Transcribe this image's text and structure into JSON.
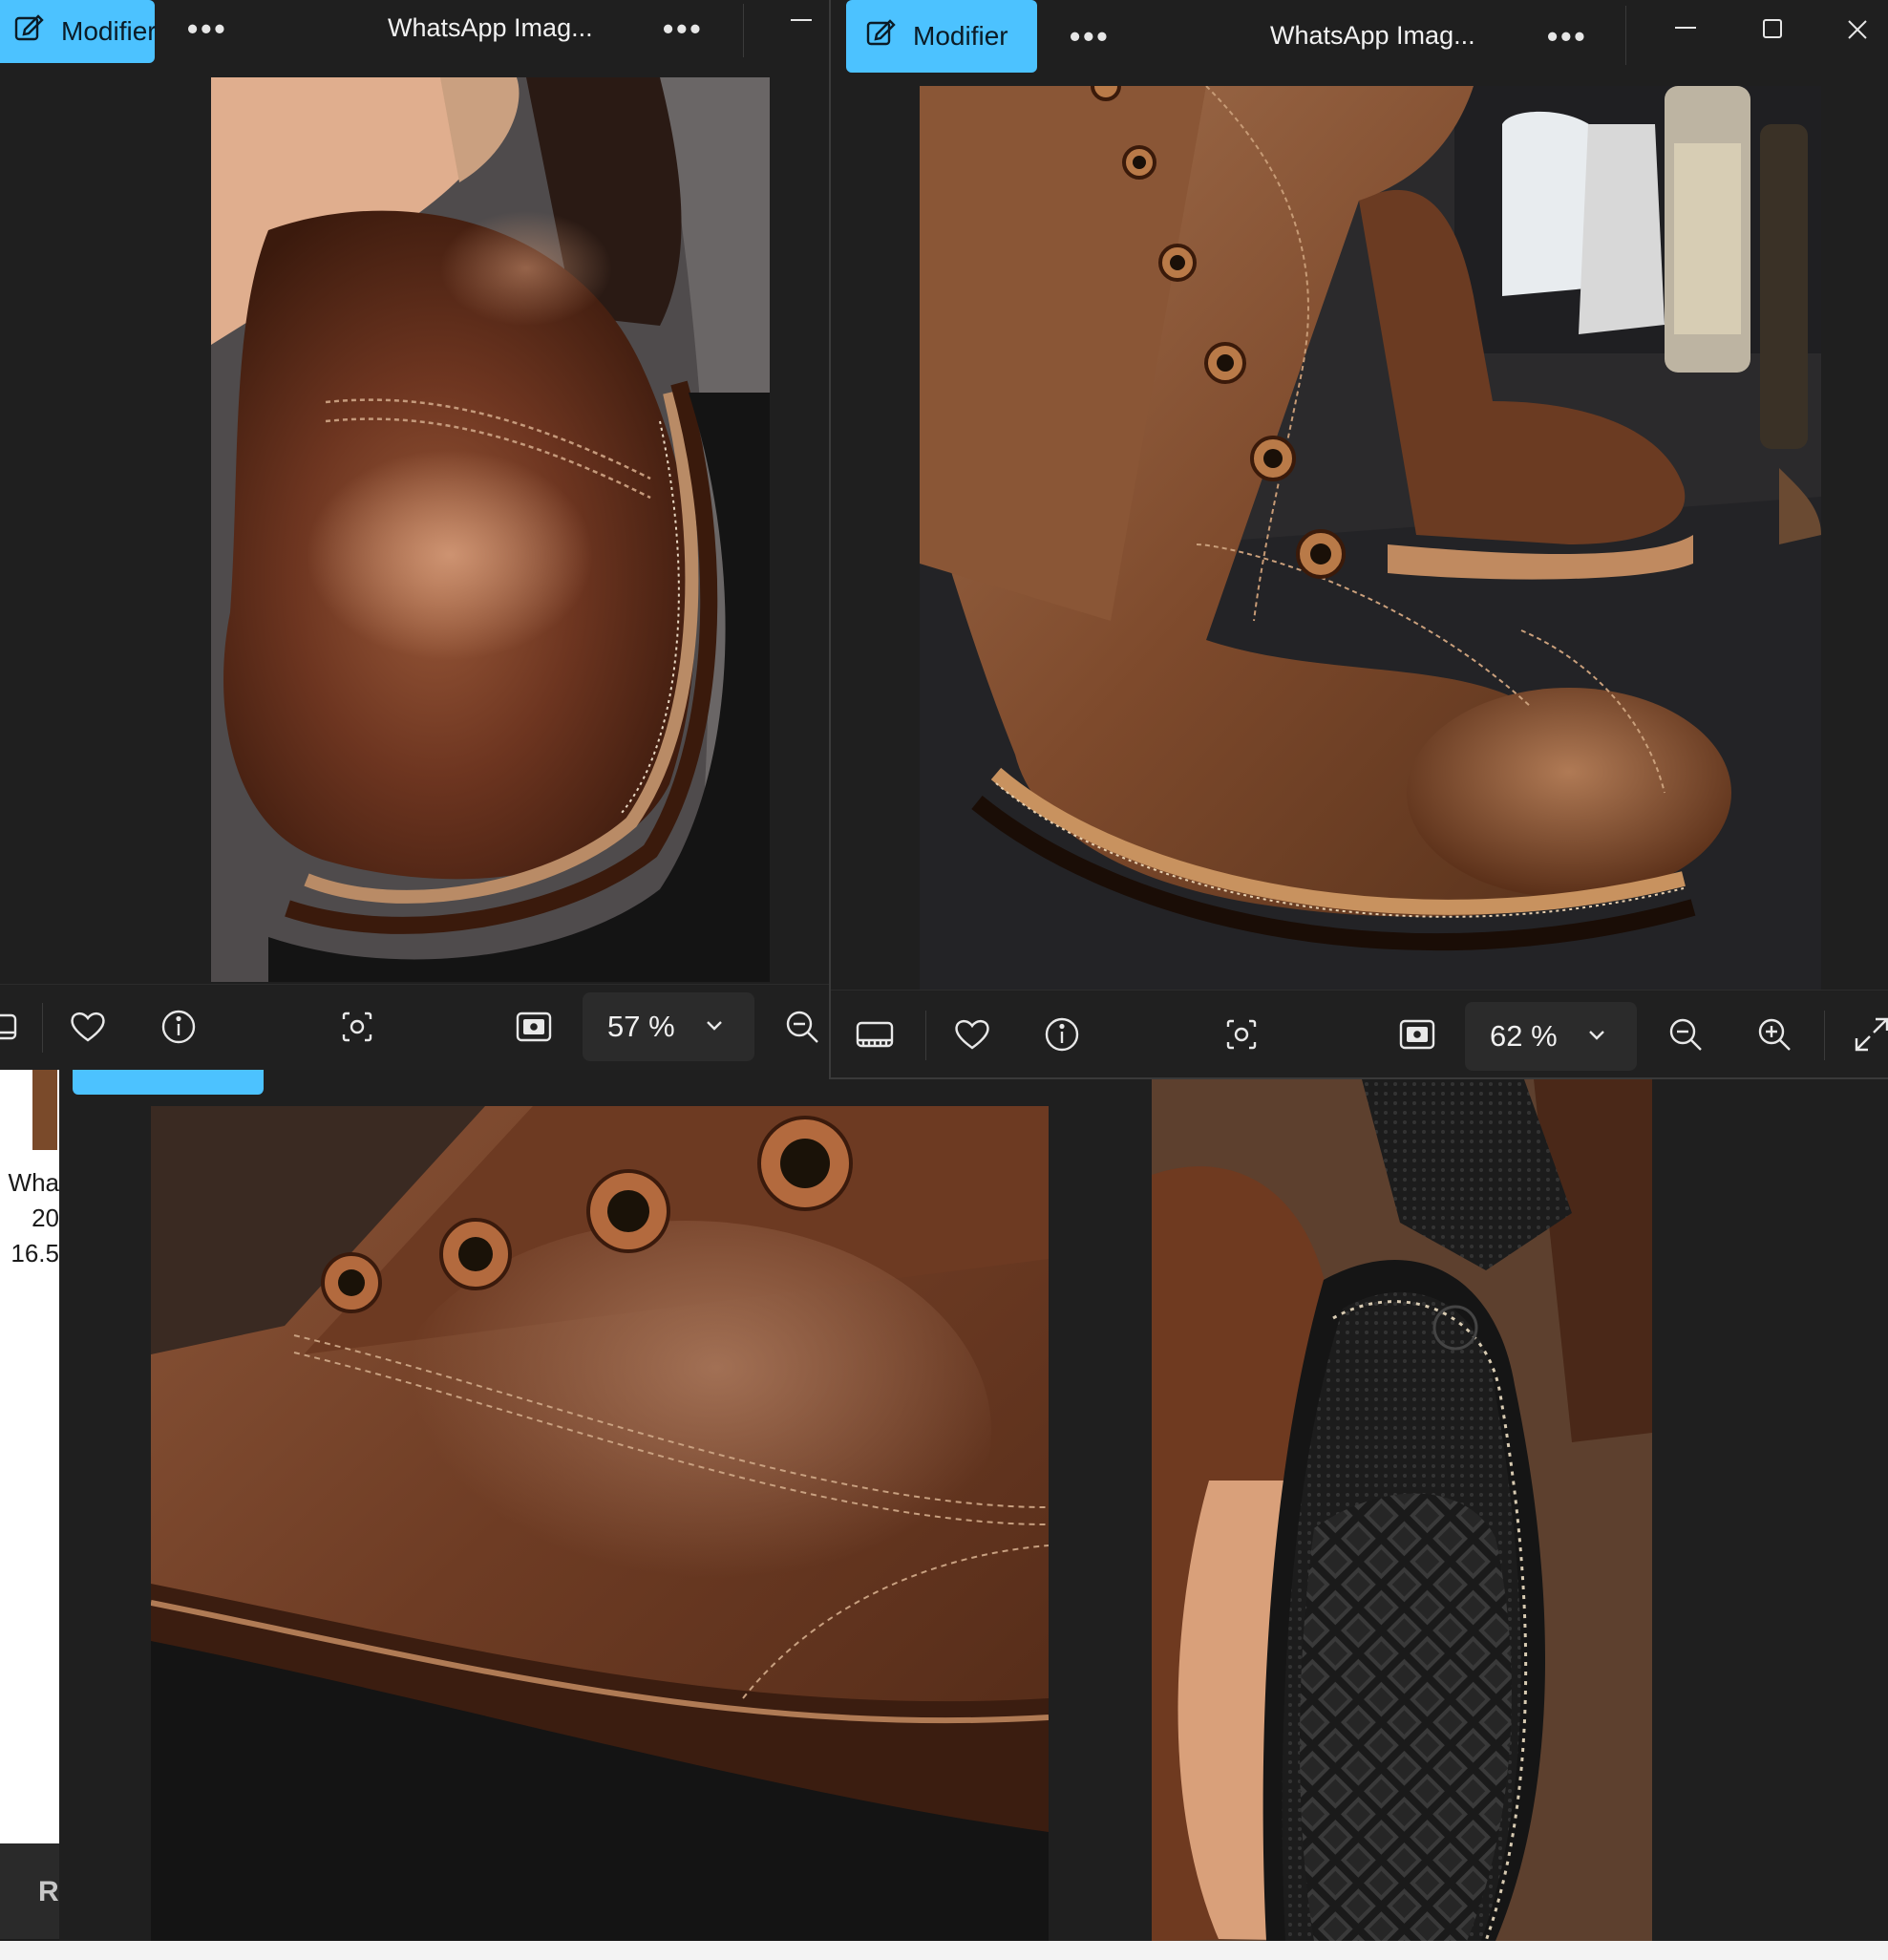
{
  "windows": [
    {
      "modify_label": "Modifier",
      "title": "WhatsApp Imag...",
      "zoom": "57 %"
    },
    {
      "modify_label": "Modifier",
      "title": "WhatsApp Imag...",
      "zoom": "62 %"
    }
  ],
  "explorer": {
    "file_name_lines": [
      "Wha",
      "20",
      "16.5"
    ],
    "status_text": "R"
  },
  "icons": {
    "modify": "edit-image-icon",
    "more": "more-dots-icon",
    "minimize": "minimize-icon",
    "maximize": "maximize-icon",
    "close": "close-icon",
    "filmstrip": "filmstrip-icon",
    "favorite": "heart-icon",
    "info": "info-icon",
    "visual_search": "scan-icon",
    "fit": "fit-to-window-icon",
    "zoom_out": "zoom-out-icon",
    "zoom_in": "zoom-in-icon",
    "fullscreen": "expand-icon"
  },
  "colors": {
    "accent": "#4cc2ff",
    "window_bg": "#1f1f1f",
    "leather": "#7a4328",
    "sole": "#1b1b1b"
  }
}
